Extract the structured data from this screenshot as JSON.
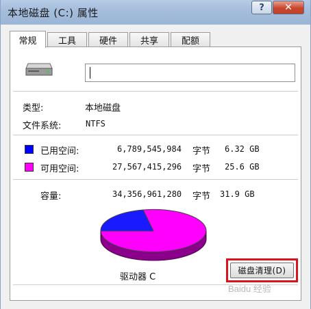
{
  "window": {
    "title": "本地磁盘 (C:) 属性",
    "help_glyph": "?",
    "close_glyph": "✕"
  },
  "tabs": [
    {
      "label": "常规",
      "active": true
    },
    {
      "label": "工具",
      "active": false
    },
    {
      "label": "硬件",
      "active": false
    },
    {
      "label": "共享",
      "active": false
    },
    {
      "label": "配额",
      "active": false
    }
  ],
  "general": {
    "drive_icon": "hard-drive-icon",
    "name_value": "",
    "type_label": "类型:",
    "type_value": "本地磁盘",
    "fs_label": "文件系统:",
    "fs_value": "NTFS",
    "used": {
      "label": "已用空间:",
      "bytes": "6,789,545,984",
      "unit": "字节",
      "size": "6.32 GB",
      "color": "#0000ff"
    },
    "free": {
      "label": "可用空间:",
      "bytes": "27,567,415,296",
      "unit": "字节",
      "size": "25.6 GB",
      "color": "#ff00ff"
    },
    "capacity": {
      "label": "容量:",
      "bytes": "34,356,961,280",
      "unit": "字节",
      "size": "31.9 GB"
    },
    "drive_label": "驱动器 C",
    "cleanup_button": "磁盘清理(D)",
    "highlight_color": "#d8141c"
  },
  "watermark": "Baidu 经验"
}
